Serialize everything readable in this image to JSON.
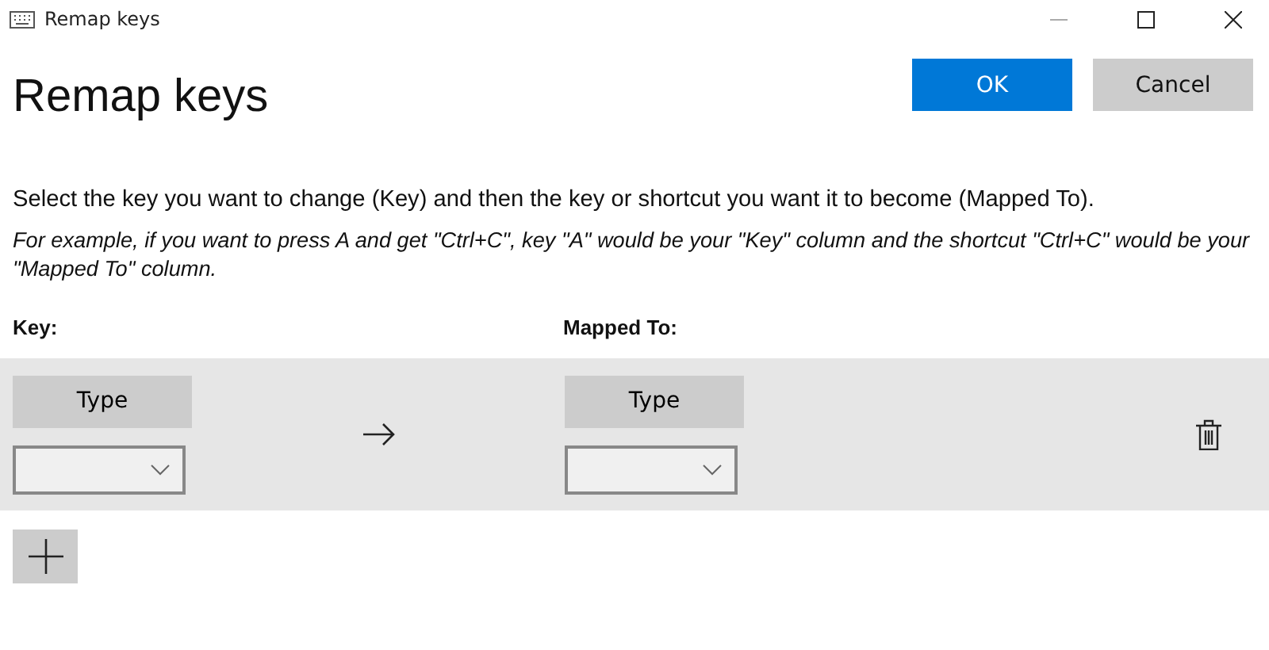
{
  "window": {
    "title": "Remap keys"
  },
  "heading": "Remap keys",
  "buttons": [
    {
      "label": "OK",
      "kind": "primary"
    },
    {
      "label": "Cancel",
      "kind": "secondary"
    }
  ],
  "instruction": "Select the key you want to change (Key) and then the key or shortcut you want it to become (Mapped To).",
  "example": "For example, if you want to press A and get \"Ctrl+C\", key \"A\" would be your \"Key\" column and the shortcut \"Ctrl+C\" would be your \"Mapped To\" column.",
  "columns": [
    "Key:",
    "Mapped To:"
  ],
  "rows": [
    {
      "key_button": "Type",
      "mapped_button": "Type"
    }
  ]
}
